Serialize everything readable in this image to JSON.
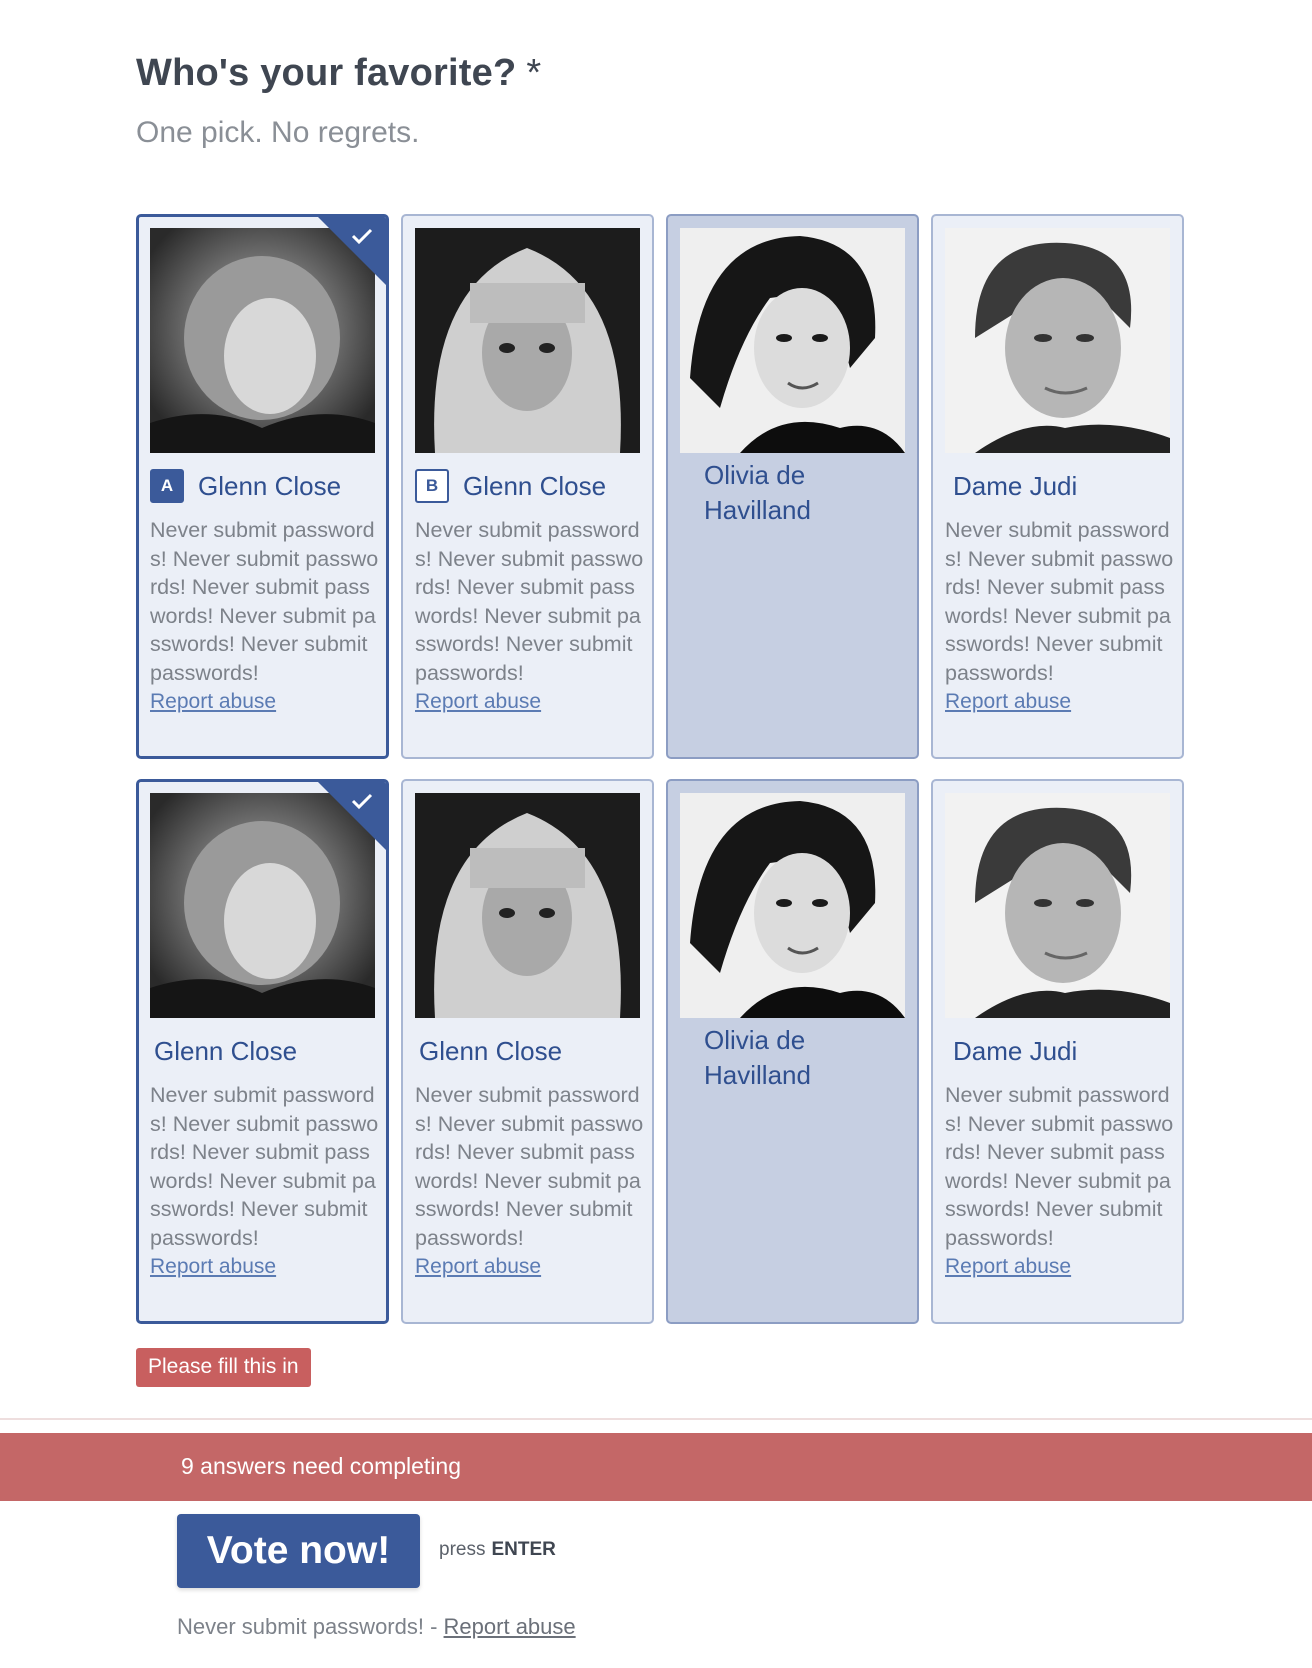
{
  "question": {
    "title": "Who's your favorite?",
    "required_marker": "*",
    "subtitle": "One pick. No regrets."
  },
  "cards": [
    {
      "key": "A",
      "name": "Glenn Close",
      "description": "Never submit passwords! Never submit passwords! Never submit passwords! Never submit passwords! Never submit passwords!",
      "report_label": "Report abuse",
      "selected": true
    },
    {
      "key": "B",
      "name": "Glenn Close",
      "description": "Never submit passwords! Never submit passwords! Never submit passwords! Never submit passwords! Never submit passwords!",
      "report_label": "Report abuse",
      "selected": false
    },
    {
      "name": "Olivia de Havilland",
      "selected": false
    },
    {
      "name": "Dame Judi",
      "description": "Never submit passwords! Never submit passwords! Never submit passwords! Never submit passwords! Never submit passwords!",
      "report_label": "Report abuse",
      "selected": false
    },
    {
      "name": "Glenn Close",
      "description": "Never submit passwords! Never submit passwords! Never submit passwords! Never submit passwords! Never submit passwords!",
      "report_label": "Report abuse",
      "selected": true
    },
    {
      "name": "Glenn Close",
      "description": "Never submit passwords! Never submit passwords! Never submit passwords! Never submit passwords! Never submit passwords!",
      "report_label": "Report abuse",
      "selected": false
    },
    {
      "name": "Olivia de Havilland",
      "selected": false
    },
    {
      "name": "Dame Judi",
      "description": "Never submit passwords! Never submit passwords! Never submit passwords! Never submit passwords! Never submit passwords!",
      "report_label": "Report abuse",
      "selected": false
    }
  ],
  "error": {
    "label": "Please fill this in"
  },
  "status": {
    "text": "9 answers need completing"
  },
  "vote": {
    "button_label": "Vote now!",
    "hint_prefix": "press",
    "hint_key": "ENTER"
  },
  "footer": {
    "text": "Never submit passwords! -",
    "link": "Report abuse"
  },
  "icons": {
    "checkmark": "check-icon",
    "photo": "portrait-photo"
  },
  "colors": {
    "accent": "#3b5a9a",
    "card_bg": "#ebeff7",
    "card_dim_bg": "#c6cfe2",
    "error": "#c85f5f",
    "status_bar": "#c46767"
  }
}
